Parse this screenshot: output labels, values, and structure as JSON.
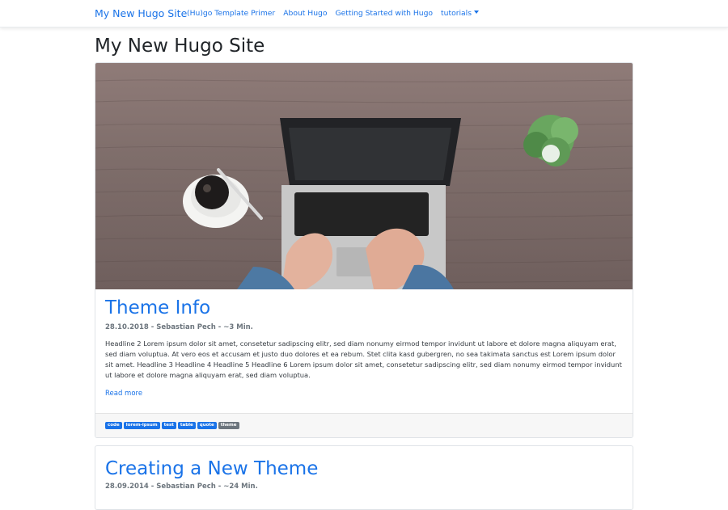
{
  "site": {
    "brand": "My New Hugo Site",
    "nav": [
      {
        "label": "(Hu)go Template Primer"
      },
      {
        "label": "About Hugo"
      },
      {
        "label": "Getting Started with Hugo"
      },
      {
        "label": "tutorials",
        "dropdown": true
      }
    ]
  },
  "page": {
    "title": "My New Hugo Site"
  },
  "posts": [
    {
      "title": "Theme Info",
      "meta": "28.10.2018 - Sebastian Pech - ~3 Min.",
      "excerpt": "Headline 2 Lorem ipsum dolor sit amet, consetetur sadipscing elitr, sed diam nonumy eirmod tempor invidunt ut labore et dolore magna aliquyam erat, sed diam voluptua. At vero eos et accusam et justo duo dolores et ea rebum. Stet clita kasd gubergren, no sea takimata sanctus est Lorem ipsum dolor sit amet. Headline 3 Headline 4 Headline 5 Headline 6 Lorem ipsum dolor sit amet, consetetur sadipscing elitr, sed diam nonumy eirmod tempor invidunt ut labore et dolore magna aliquyam erat, sed diam voluptua.",
      "read_more": "Read more",
      "tags": [
        "code",
        "lorem-ipsum",
        "test",
        "table",
        "quote",
        "theme"
      ]
    },
    {
      "title": "Creating a New Theme",
      "meta": "28.09.2014 - Sebastian Pech - ~24 Min."
    }
  ],
  "colors": {
    "link": "#1a73e8",
    "tag": "#1a73e8",
    "tag_muted": "#6c757d"
  },
  "icons": {
    "dropdown": "caret-down-icon"
  }
}
